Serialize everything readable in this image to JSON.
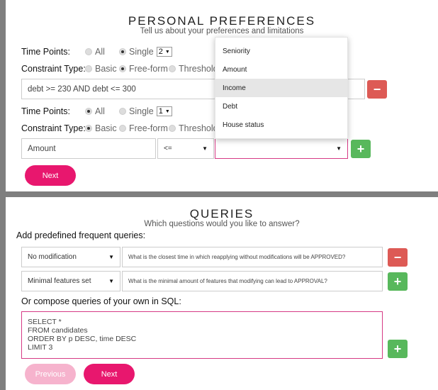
{
  "personal": {
    "title": "PERSONAL PREFERENCES",
    "subtitle": "Tell us about your preferences and limitations",
    "block1": {
      "time_points_label": "Time Points:",
      "opt_all": "All",
      "opt_single": "Single",
      "single_value": "2",
      "constraint_label": "Constraint Type:",
      "opt_basic": "Basic",
      "opt_freeform": "Free-form",
      "opt_threshold": "Threshold",
      "expression": "debt >= 230 AND debt <= 300"
    },
    "block2": {
      "time_points_label": "Time Points:",
      "opt_all": "All",
      "opt_single": "Single",
      "single_value": "1",
      "constraint_label": "Constraint Type:",
      "opt_basic": "Basic",
      "opt_freeform": "Free-form",
      "opt_threshold": "Threshold",
      "feature": "Amount",
      "operator": "<="
    },
    "dropdown_options": [
      "Seniority",
      "Amount",
      "Income",
      "Debt",
      "House status"
    ],
    "next_label": "Next"
  },
  "queries": {
    "title": "QUERIES",
    "subtitle": "Which questions would you like to answer?",
    "predefined_label": "Add predefined frequent queries:",
    "rows": [
      {
        "select": "No modification",
        "question": "What is the closest time in which reapplying without modifications will be APPROVED?"
      },
      {
        "select": "Minimal features set",
        "question": "What is the minimal amount of features that modifying can lead to APPROVAL?"
      }
    ],
    "compose_label": "Or compose queries of your own in SQL:",
    "sql": "SELECT *\nFROM candidates\nORDER BY p DESC, time DESC\nLIMIT 3",
    "previous_label": "Previous",
    "next_label": "Next"
  },
  "colors": {
    "accent": "#e8176e",
    "danger": "#dd5a55",
    "success": "#58b85c",
    "disabled": "#f6b3cd"
  }
}
